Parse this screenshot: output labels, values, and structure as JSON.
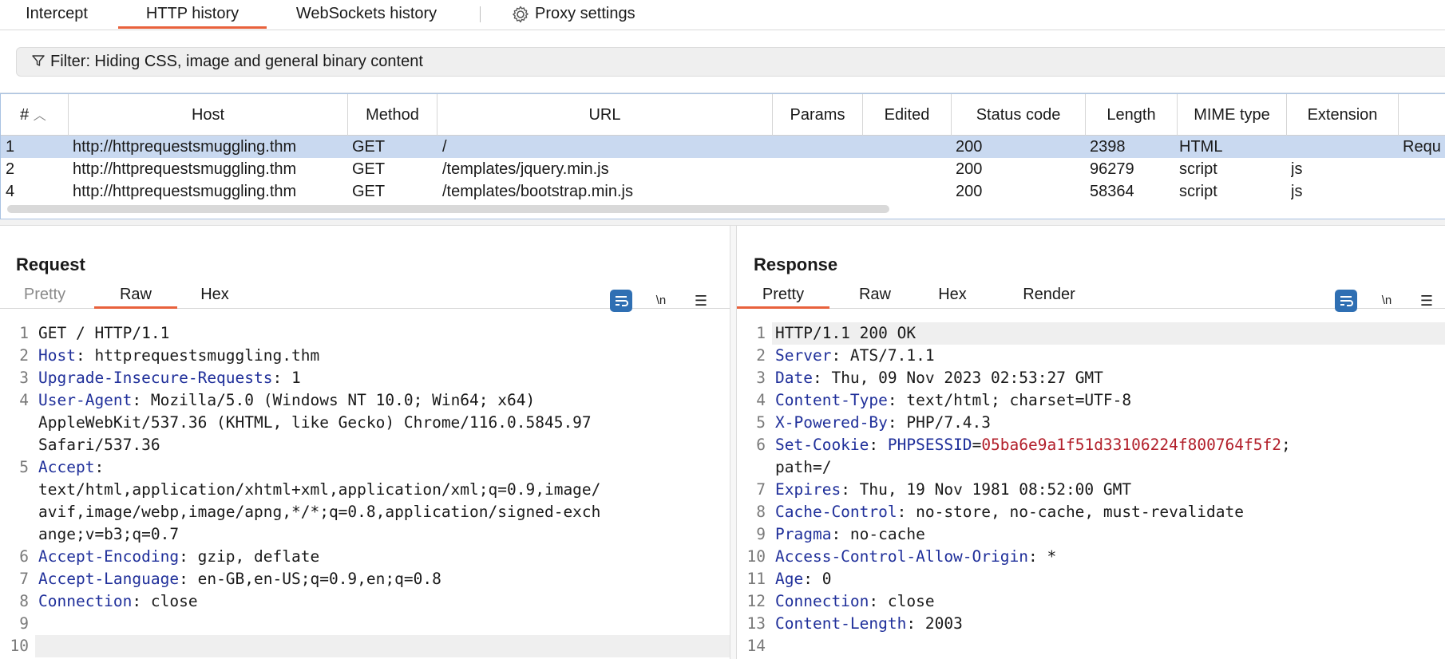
{
  "top_tabs": [
    {
      "label": "Intercept"
    },
    {
      "label": "HTTP history"
    },
    {
      "label": "WebSockets history"
    },
    {
      "label": "Proxy settings"
    }
  ],
  "filter": {
    "text": "Filter: Hiding CSS, image and general binary content"
  },
  "table": {
    "headers": [
      "#",
      "Host",
      "Method",
      "URL",
      "Params",
      "Edited",
      "Status code",
      "Length",
      "MIME type",
      "Extension"
    ],
    "rows": [
      {
        "num": "1",
        "host": "http://httprequestsmuggling.thm",
        "method": "GET",
        "url": "/",
        "status": "200",
        "length": "2398",
        "mime": "HTML",
        "ext": "",
        "extra": "Requ"
      },
      {
        "num": "2",
        "host": "http://httprequestsmuggling.thm",
        "method": "GET",
        "url": "/templates/jquery.min.js",
        "status": "200",
        "length": "96279",
        "mime": "script",
        "ext": "js",
        "extra": ""
      },
      {
        "num": "4",
        "host": "http://httprequestsmuggling.thm",
        "method": "GET",
        "url": "/templates/bootstrap.min.js",
        "status": "200",
        "length": "58364",
        "mime": "script",
        "ext": "js",
        "extra": ""
      }
    ]
  },
  "request": {
    "title": "Request",
    "tabs": [
      "Pretty",
      "Raw",
      "Hex"
    ],
    "tools": {
      "newline": "\\n"
    },
    "lines": [
      {
        "n": "1",
        "k": "",
        "v": "GET / HTTP/1.1"
      },
      {
        "n": "2",
        "k": "Host",
        "v": ": httprequestsmuggling.thm"
      },
      {
        "n": "3",
        "k": "Upgrade-Insecure-Requests",
        "v": ": 1"
      },
      {
        "n": "4",
        "k": "User-Agent",
        "v": ": Mozilla/5.0 (Windows NT 10.0; Win64; x64)"
      },
      {
        "n": "",
        "k": "",
        "v": "AppleWebKit/537.36 (KHTML, like Gecko) Chrome/116.0.5845.97"
      },
      {
        "n": "",
        "k": "",
        "v": "Safari/537.36"
      },
      {
        "n": "5",
        "k": "Accept",
        "v": ":"
      },
      {
        "n": "",
        "k": "",
        "v": "text/html,application/xhtml+xml,application/xml;q=0.9,image/"
      },
      {
        "n": "",
        "k": "",
        "v": "avif,image/webp,image/apng,*/*;q=0.8,application/signed-exch"
      },
      {
        "n": "",
        "k": "",
        "v": "ange;v=b3;q=0.7"
      },
      {
        "n": "6",
        "k": "Accept-Encoding",
        "v": ": gzip, deflate"
      },
      {
        "n": "7",
        "k": "Accept-Language",
        "v": ": en-GB,en-US;q=0.9,en;q=0.8"
      },
      {
        "n": "8",
        "k": "Connection",
        "v": ": close"
      },
      {
        "n": "9",
        "k": "",
        "v": ""
      },
      {
        "n": "10",
        "k": "",
        "v": ""
      }
    ]
  },
  "response": {
    "title": "Response",
    "tabs": [
      "Pretty",
      "Raw",
      "Hex",
      "Render"
    ],
    "tools": {
      "newline": "\\n"
    },
    "lines": [
      {
        "n": "1",
        "k": "",
        "v": "HTTP/1.1 200 OK"
      },
      {
        "n": "2",
        "k": "Server",
        "v": ": ATS/7.1.1"
      },
      {
        "n": "3",
        "k": "Date",
        "v": ": Thu, 09 Nov 2023 02:53:27 GMT"
      },
      {
        "n": "4",
        "k": "Content-Type",
        "v": ": text/html; charset=UTF-8"
      },
      {
        "n": "5",
        "k": "X-Powered-By",
        "v": ": PHP/7.4.3"
      },
      {
        "n": "6",
        "k": "Set-Cookie",
        "v": ": ",
        "ck": "PHPSESSID",
        "eq": "=",
        "cv": "05ba6e9a1f51d33106224f800764f5f2",
        "tail": ";"
      },
      {
        "n": "",
        "k": "",
        "v": "path=/"
      },
      {
        "n": "7",
        "k": "Expires",
        "v": ": Thu, 19 Nov 1981 08:52:00 GMT"
      },
      {
        "n": "8",
        "k": "Cache-Control",
        "v": ": no-store, no-cache, must-revalidate"
      },
      {
        "n": "9",
        "k": "Pragma",
        "v": ": no-cache"
      },
      {
        "n": "10",
        "k": "Access-Control-Allow-Origin",
        "v": ": *"
      },
      {
        "n": "11",
        "k": "Age",
        "v": ": 0"
      },
      {
        "n": "12",
        "k": "Connection",
        "v": ": close"
      },
      {
        "n": "13",
        "k": "Content-Length",
        "v": ": 2003"
      },
      {
        "n": "14",
        "k": "",
        "v": ""
      }
    ]
  },
  "colors": {
    "accent": "#e8613c",
    "header_key": "#1f2f9a",
    "cookie_value": "#b21f2a",
    "selected_row": "#c9d9f0",
    "toolbar_blue": "#2f6fb3"
  }
}
